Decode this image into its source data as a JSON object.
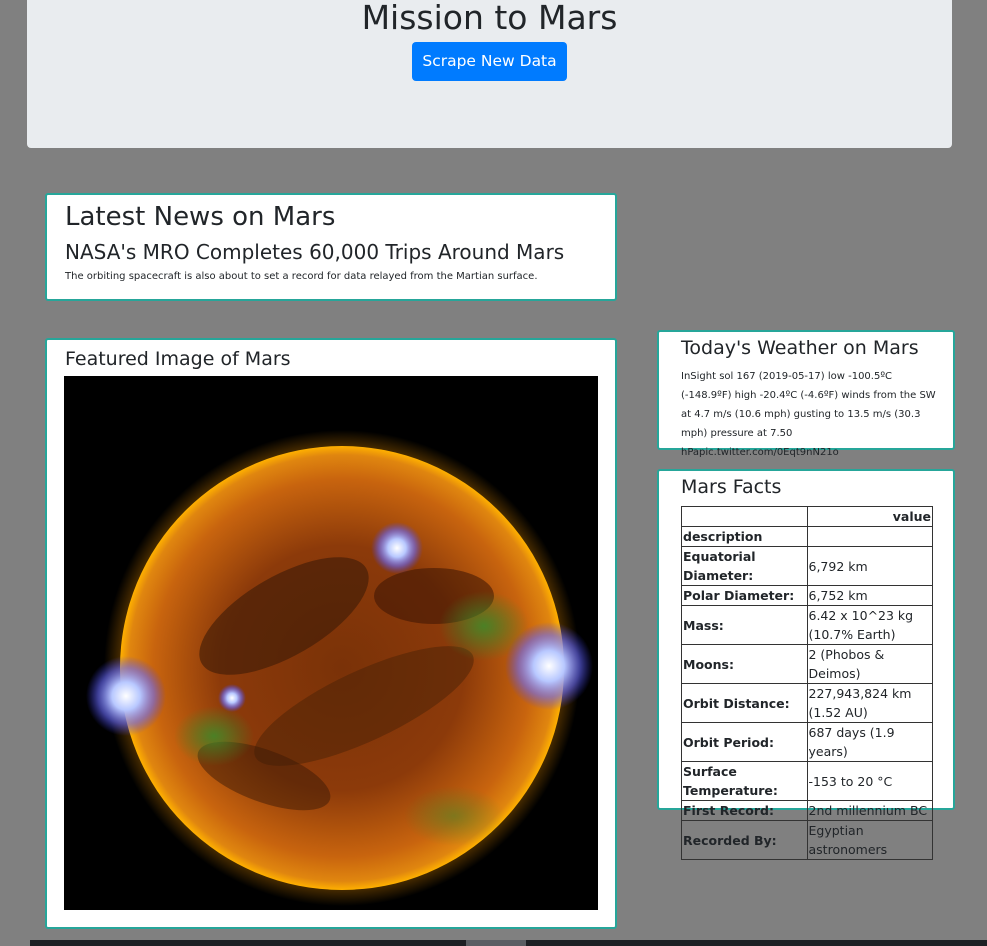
{
  "header": {
    "title": "Mission to Mars",
    "scrape_button": "Scrape New Data"
  },
  "news": {
    "heading": "Latest News on Mars",
    "title": "NASA's MRO Completes 60,000 Trips Around Mars",
    "teaser": "The orbiting spacecraft is also about to set a record for data relayed from the Martian surface."
  },
  "featured": {
    "heading": "Featured Image of Mars"
  },
  "weather": {
    "heading": "Today's Weather on Mars",
    "report": "InSight sol 167 (2019-05-17) low -100.5ºC (-148.9ºF) high -20.4ºC (-4.6ºF) winds from the SW at 4.7 m/s (10.6 mph) gusting to 13.5 m/s (30.3 mph) pressure at 7.50 hPapic.twitter.com/0Eqt9nN21o"
  },
  "facts": {
    "heading": "Mars Facts",
    "col_header": "value",
    "index_label": "description",
    "rows": [
      {
        "label": "Equatorial Diameter:",
        "value": "6,792 km"
      },
      {
        "label": "Polar Diameter:",
        "value": "6,752 km"
      },
      {
        "label": "Mass:",
        "value": "6.42 x 10^23 kg (10.7% Earth)"
      },
      {
        "label": "Moons:",
        "value": "2 (Phobos & Deimos)"
      },
      {
        "label": "Orbit Distance:",
        "value": "227,943,824 km (1.52 AU)"
      },
      {
        "label": "Orbit Period:",
        "value": "687 days (1.9 years)"
      },
      {
        "label": "Surface Temperature:",
        "value": "-153 to 20 °C"
      },
      {
        "label": "First Record:",
        "value": "2nd millennium BC"
      },
      {
        "label": "Recorded By:",
        "value": "Egyptian astronomers"
      }
    ]
  },
  "colors": {
    "page_bg": "#808080",
    "jumbotron_bg": "#e9ecef",
    "button_bg": "#007bff",
    "card_border": "#26a69a"
  }
}
